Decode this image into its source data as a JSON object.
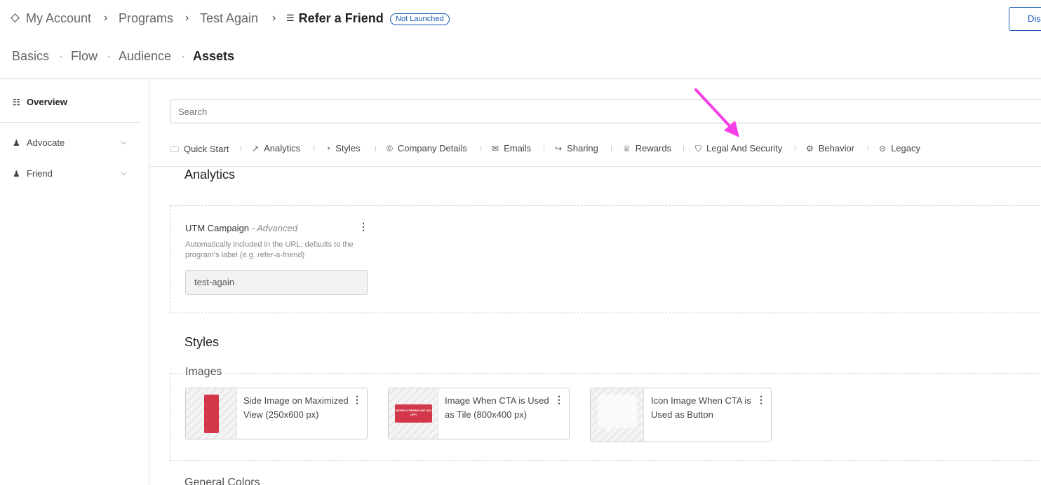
{
  "breadcrumb": {
    "items": [
      "My Account",
      "Programs",
      "Test Again"
    ],
    "current": "Refer a Friend",
    "status_badge": "Not Launched"
  },
  "discard_button": "Discard",
  "program_tabs": [
    "Basics",
    "Flow",
    "Audience",
    "Assets"
  ],
  "active_program_tab": "Assets",
  "sidebar": {
    "overview": "Overview",
    "items": [
      {
        "label": "Advocate",
        "icon": "person-icon"
      },
      {
        "label": "Friend",
        "icon": "person-icon"
      }
    ]
  },
  "search": {
    "placeholder": "Search"
  },
  "asset_tabs": [
    {
      "label": "Quick Start",
      "icon": "folder-icon"
    },
    {
      "label": "Analytics",
      "icon": "trend-icon"
    },
    {
      "label": "Styles",
      "icon": "palette-icon"
    },
    {
      "label": "Company Details",
      "icon": "copyright-icon"
    },
    {
      "label": "Emails",
      "icon": "mail-icon"
    },
    {
      "label": "Sharing",
      "icon": "share-icon"
    },
    {
      "label": "Rewards",
      "icon": "trophy-icon"
    },
    {
      "label": "Legal And Security",
      "icon": "shield-icon"
    },
    {
      "label": "Behavior",
      "icon": "behavior-icon"
    },
    {
      "label": "Legacy",
      "icon": "minus-circle-icon"
    }
  ],
  "analytics": {
    "title": "Analytics",
    "utm": {
      "label": "UTM Campaign",
      "qualifier": "- Advanced",
      "help": "Automatically included in the URL; defaults to the program's label (e.g. refer-a-friend)",
      "value": "test-again"
    }
  },
  "styles": {
    "title": "Styles",
    "images_legend": "Images",
    "cards": [
      {
        "label": "Side Image on Maximized View (250x600 px)"
      },
      {
        "label": "Image When CTA is Used as Tile (800x400 px)",
        "thumb_text": "REFER A FRIEND GET $20 OFF!"
      },
      {
        "label": "Icon Image When CTA is Used as Button"
      }
    ]
  },
  "next_section_title": "General Colors",
  "colors": {
    "accent_blue": "#1a5bb5",
    "annotation_arrow": "#f53ee6",
    "thumb_red": "#d2384a"
  }
}
